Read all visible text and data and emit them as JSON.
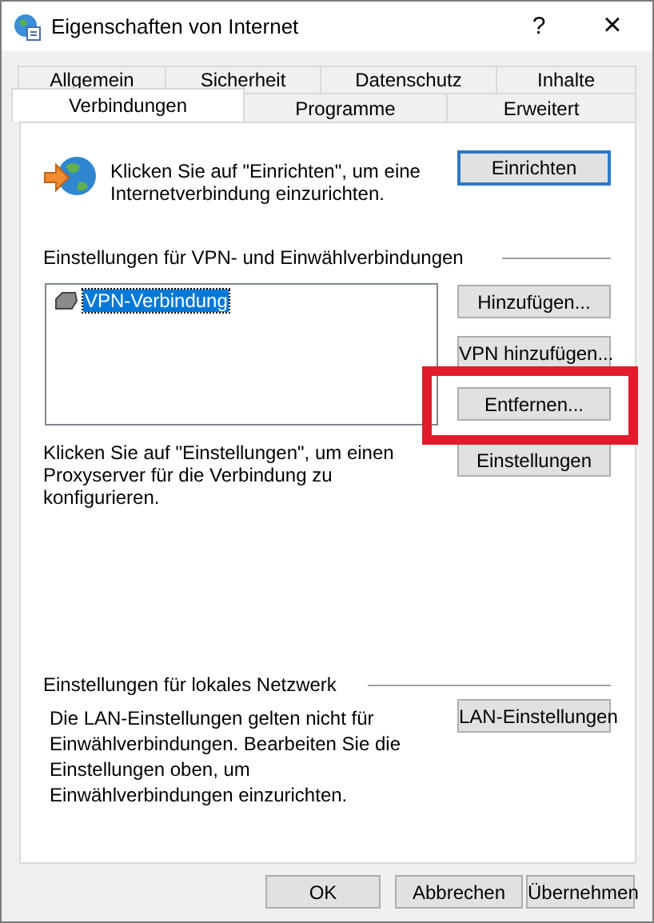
{
  "window": {
    "title": "Eigenschaften von Internet",
    "help": "?",
    "close": "×"
  },
  "tabs": [
    [
      {
        "label": "Allgemein",
        "selected": false
      },
      {
        "label": "Sicherheit",
        "selected": false
      },
      {
        "label": "Datenschutz",
        "selected": false
      },
      {
        "label": "Inhalte",
        "selected": false
      }
    ],
    [
      {
        "label": "Verbindungen",
        "selected": true
      },
      {
        "label": "Programme",
        "selected": false
      },
      {
        "label": "Erweitert",
        "selected": false
      }
    ]
  ],
  "setup": {
    "text": "Klicken Sie auf \"Einrichten\", um eine Internetverbindung einzurichten.",
    "button": "Einrichten"
  },
  "vpn_group": {
    "label": "Einstellungen für VPN- und Einwählverbindungen",
    "connections": [
      {
        "name": "VPN-Verbindung",
        "selected": true
      }
    ],
    "buttons": [
      {
        "label": "Hinzufügen...",
        "highlighted": false
      },
      {
        "label": "VPN hinzufügen...",
        "highlighted": false
      },
      {
        "label": "Entfernen...",
        "highlighted": true
      }
    ],
    "proxy_text": "Klicken Sie auf \"Einstellungen\", um einen Proxyserver für die Verbindung zu konfigurieren.",
    "settings_button": "Einstellungen"
  },
  "lan_group": {
    "label": "Einstellungen für lokales Netzwerk",
    "text": "Die LAN-Einstellungen gelten nicht für Einwählverbindungen. Bearbeiten Sie die Einstellungen oben, um Einwählverbindungen einzurichten.",
    "button": "LAN-Einstellungen"
  },
  "footer_buttons": [
    "OK",
    "Abbrechen",
    "Übernehmen"
  ]
}
